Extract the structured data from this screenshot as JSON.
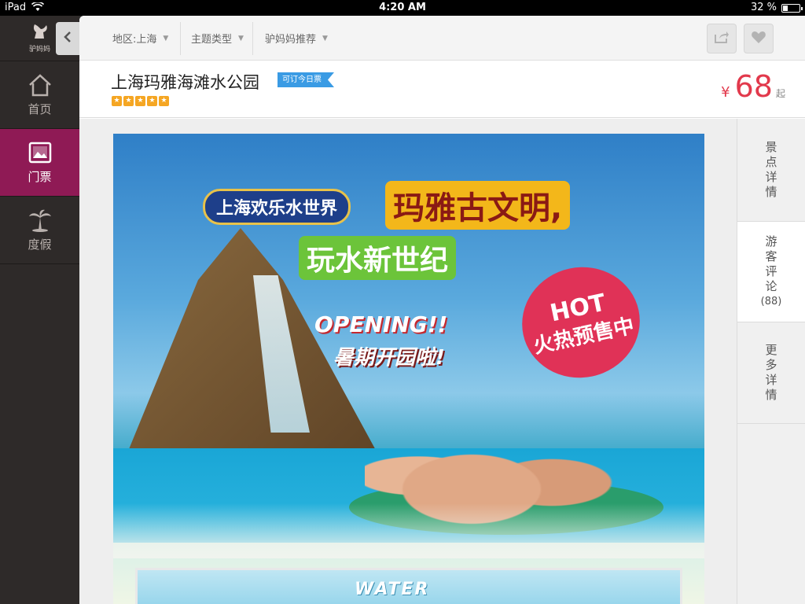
{
  "status_bar": {
    "carrier": "iPad",
    "time": "4:20 AM",
    "battery": "32 %",
    "battery_level": 0.32
  },
  "sidebar": {
    "logo_text": "驴妈妈",
    "logo_icon": "rabbit-logo-icon",
    "items": [
      {
        "label": "首页",
        "icon": "home-icon",
        "active": false
      },
      {
        "label": "门票",
        "icon": "picture-icon",
        "active": true
      },
      {
        "label": "度假",
        "icon": "palm-tree-icon",
        "active": false
      }
    ]
  },
  "back_button": {
    "icon": "chevron-left-icon"
  },
  "topbar": {
    "filters": [
      {
        "label": "地区:上海"
      },
      {
        "label": "主题类型"
      },
      {
        "label": "驴妈妈推荐"
      }
    ],
    "share_icon": "share-icon",
    "favorite_icon": "heart-icon"
  },
  "attraction": {
    "title": "上海玛雅海滩水公园",
    "badge": "可订今日票",
    "rating": 5,
    "price": {
      "currency": "¥",
      "amount": "68",
      "suffix": "起"
    }
  },
  "poster": {
    "banner_title": "上海欢乐水世界",
    "headline": "玛雅古文明,",
    "subline": "玩水新世纪",
    "opening": "OPENING!!",
    "opening_cn": "暑期开园啦!",
    "hot": "HOT",
    "hot_cn": "火热预售中",
    "sub_banner": "WATER"
  },
  "right_tabs": [
    {
      "label": "景点详情",
      "count": "",
      "active": false
    },
    {
      "label": "游客评论",
      "count": "(88)",
      "active": true
    },
    {
      "label": "更多详情",
      "count": "",
      "active": false
    }
  ],
  "colors": {
    "accent": "#8f1a55",
    "price": "#e2394c",
    "badge": "#3a9be4",
    "star": "#f5a623"
  }
}
